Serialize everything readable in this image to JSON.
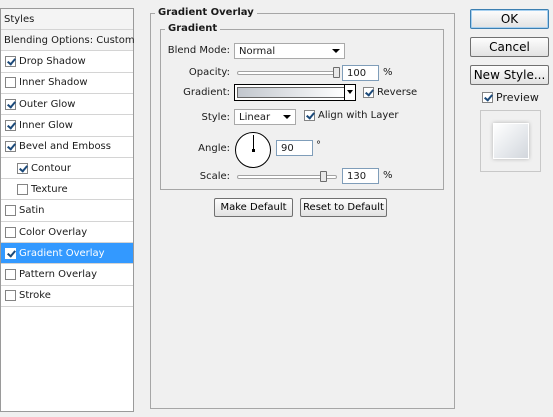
{
  "styles_panel": {
    "header": "Styles",
    "items": [
      {
        "label": "Blending Options: Custom",
        "checkbox": false,
        "checked": false,
        "indent": false,
        "selected": false
      },
      {
        "label": "Drop Shadow",
        "checkbox": true,
        "checked": true,
        "indent": false,
        "selected": false
      },
      {
        "label": "Inner Shadow",
        "checkbox": true,
        "checked": false,
        "indent": false,
        "selected": false
      },
      {
        "label": "Outer Glow",
        "checkbox": true,
        "checked": true,
        "indent": false,
        "selected": false
      },
      {
        "label": "Inner Glow",
        "checkbox": true,
        "checked": true,
        "indent": false,
        "selected": false
      },
      {
        "label": "Bevel and Emboss",
        "checkbox": true,
        "checked": true,
        "indent": false,
        "selected": false
      },
      {
        "label": "Contour",
        "checkbox": true,
        "checked": true,
        "indent": true,
        "selected": false
      },
      {
        "label": "Texture",
        "checkbox": true,
        "checked": false,
        "indent": true,
        "selected": false
      },
      {
        "label": "Satin",
        "checkbox": true,
        "checked": false,
        "indent": false,
        "selected": false
      },
      {
        "label": "Color Overlay",
        "checkbox": true,
        "checked": false,
        "indent": false,
        "selected": false
      },
      {
        "label": "Gradient Overlay",
        "checkbox": true,
        "checked": true,
        "indent": false,
        "selected": true
      },
      {
        "label": "Pattern Overlay",
        "checkbox": true,
        "checked": false,
        "indent": false,
        "selected": false
      },
      {
        "label": "Stroke",
        "checkbox": true,
        "checked": false,
        "indent": false,
        "selected": false
      }
    ]
  },
  "gradient_overlay": {
    "title": "Gradient Overlay",
    "section_title": "Gradient",
    "blend_mode": {
      "label": "Blend Mode:",
      "value": "Normal"
    },
    "opacity": {
      "label": "Opacity:",
      "value": "100",
      "unit": "%",
      "slider_percent": 100
    },
    "gradient": {
      "label": "Gradient:",
      "start_color": "#c2c7ce",
      "end_color": "#ffffff"
    },
    "reverse": {
      "label": "Reverse",
      "checked": true
    },
    "style": {
      "label": "Style:",
      "value": "Linear"
    },
    "align_with_layer": {
      "label": "Align with Layer",
      "checked": true
    },
    "angle": {
      "label": "Angle:",
      "value": "90",
      "unit": "°"
    },
    "scale": {
      "label": "Scale:",
      "value": "130",
      "unit": "%",
      "slider_percent": 130
    },
    "make_default": "Make Default",
    "reset_to_default": "Reset to Default"
  },
  "actions": {
    "ok": "OK",
    "cancel": "Cancel",
    "new_style": "New Style...",
    "preview": {
      "label": "Preview",
      "checked": true
    }
  },
  "colors": {
    "selection": "#3399ff",
    "default_button_border": "#3c7fb1"
  }
}
